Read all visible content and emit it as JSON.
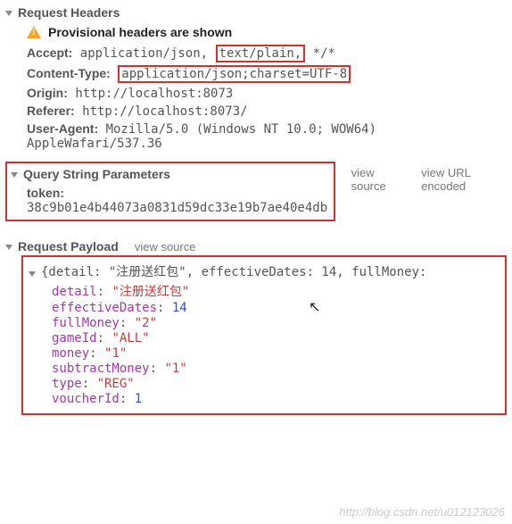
{
  "sections": {
    "requestHeaders": {
      "title": "Request Headers",
      "warning": "Provisional headers are shown",
      "rows": {
        "accept": {
          "name": "Accept:",
          "pre": "application/json, ",
          "boxed": "text/plain,",
          "post": " */*"
        },
        "contentType": {
          "name": "Content-Type:",
          "boxed": "application/json;charset=UTF-8"
        },
        "origin": {
          "name": "Origin:",
          "value": "http://localhost:8073"
        },
        "referer": {
          "name": "Referer:",
          "value": "http://localhost:8073/"
        },
        "userAgent": {
          "name": "User-Agent:",
          "value": "Mozilla/5.0 (Windows NT 10.0; WOW64) AppleWafari/537.36"
        }
      }
    },
    "queryString": {
      "title": "Query String Parameters",
      "links": {
        "viewSource": "view source",
        "viewUrlEncoded": "view URL encoded"
      },
      "token": {
        "name": "token:",
        "value": "38c9b01e4b44073a0831d59dc33e19b7ae40e4db"
      }
    },
    "requestPayload": {
      "title": "Request Payload",
      "links": {
        "viewSource": "view source"
      },
      "summary": "{detail: \"注册送红包\", effectiveDates: 14, fullMoney:",
      "props": [
        {
          "k": "detail",
          "v": "\"注册送红包\"",
          "t": "s"
        },
        {
          "k": "effectiveDates",
          "v": "14",
          "t": "n"
        },
        {
          "k": "fullMoney",
          "v": "\"2\"",
          "t": "s"
        },
        {
          "k": "gameId",
          "v": "\"ALL\"",
          "t": "s"
        },
        {
          "k": "money",
          "v": "\"1\"",
          "t": "s"
        },
        {
          "k": "subtractMoney",
          "v": "\"1\"",
          "t": "s"
        },
        {
          "k": "type",
          "v": "\"REG\"",
          "t": "s"
        },
        {
          "k": "voucherId",
          "v": "1",
          "t": "n"
        }
      ]
    }
  },
  "watermark": "http://blog.csdn.net/u012123026"
}
